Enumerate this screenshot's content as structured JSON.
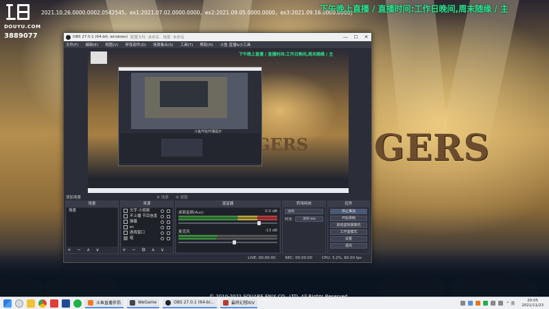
{
  "overlay": {
    "brand": "DOUYU.COM",
    "room_id": "3889077",
    "info_line": "2021.10.26.0000.0002.0542545，ex1:2021.07.02.0000.0000，ex2:2021.09.05.0000.0000，ex3:2021.09.16.0000.0000)",
    "ticker": "下午晚上直播 / 直播时间:工作日晚间,周末随缘 / 主"
  },
  "background": {
    "logo_text": "GERS",
    "copyright": "© 2010-2021 SQUARE ENIX CO., LTD. All Rights Reserved."
  },
  "obs": {
    "title": "OBS 27.0.1 (64-bit, windows)",
    "title_sub": "配置文件: 未命名 · 场景: 未命名",
    "window_controls": [
      "—",
      "☐",
      "✕"
    ],
    "menu": [
      "文件(F)",
      "编辑(E)",
      "视图(V)",
      "停靠部件(D)",
      "场景集合(S)",
      "工具(T)",
      "帮助(H)",
      "斗鱼 直播&小工具"
    ],
    "preview": {
      "ticker": "下午晚上直播 / 直播时间:工作日晚间,周末随缘 / 主",
      "inner_caption": "斗鱼开始开播提示",
      "gers": "GERS"
    },
    "scene_bar": {
      "label": "添加场景",
      "btn_a": "⚙ 场景",
      "btn_b": "⚙ 滤镜"
    },
    "docks": {
      "scenes": {
        "title": "场景",
        "items": [
          "场景"
        ],
        "foot": "+ − ∧ ∨"
      },
      "sources": {
        "title": "来源",
        "items": [
          "文字 小视频",
          "不上播 节目信息",
          "弹幕",
          "ec",
          "游戏窗口",
          "组"
        ],
        "foot": "+ − ⚙ ∧ ∨"
      },
      "mixer": {
        "title": "混音器",
        "channels": [
          {
            "name": "桌面音频(Aux)",
            "level": "0.0 dB"
          },
          {
            "name": "麦克风",
            "level": "-13 dB"
          }
        ]
      },
      "transitions": {
        "title": "转场特效",
        "type": "淡出",
        "duration_label": "时长",
        "duration": "300 ms"
      },
      "controls": {
        "title": "控件",
        "buttons": [
          "停止推流",
          "开始录制",
          "启动虚拟摄像机",
          "工作室模式",
          "设置",
          "退出"
        ]
      }
    },
    "status": {
      "live": "LIVE: 00:00:00",
      "rec": "REC: 00:00:00",
      "cpu": "CPU: 3.2%, 60.00 fps"
    }
  },
  "taskbar": {
    "tasks": [
      {
        "label": "斗鱼直播伴侣",
        "color": "#f57a1e"
      },
      {
        "label": "WeGame",
        "color": "#444444"
      },
      {
        "label": "OBS 27.0.1 (64-bi...",
        "color": "#222222"
      },
      {
        "label": "最终幻想XIV",
        "color": "#b53a2a"
      }
    ],
    "tray_text": "^ 英",
    "time": "20:05",
    "date": "2021/11/23"
  },
  "colors": {
    "ticker": "#2fe08e",
    "obs_panel": "#2b2e38",
    "selection": "#3b5a8a"
  }
}
